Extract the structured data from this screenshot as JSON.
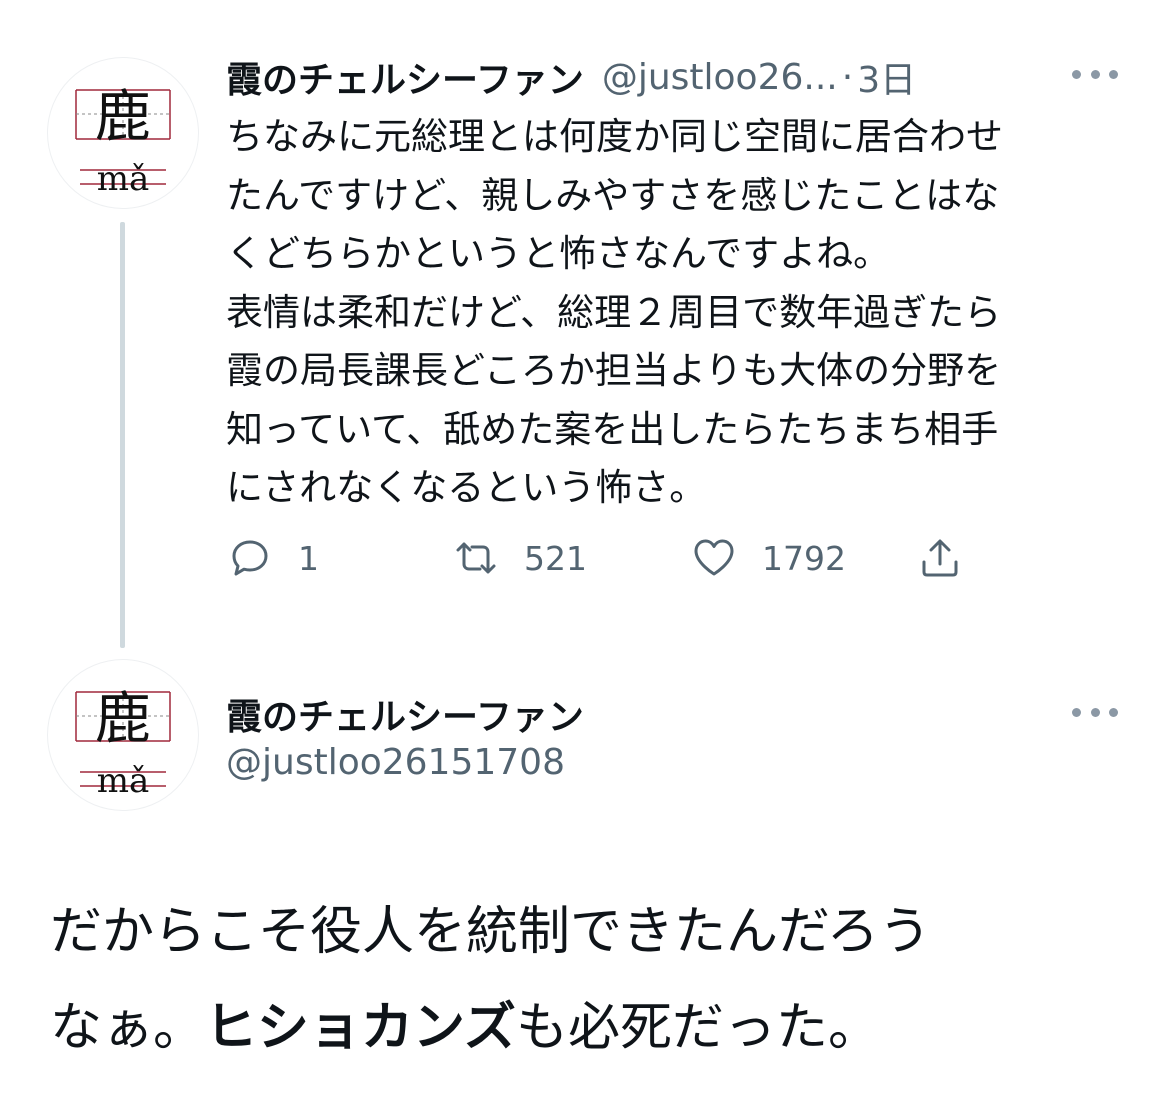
{
  "tweet1": {
    "avatar": {
      "glyph": "鹿",
      "pinyin": "mǎ"
    },
    "display_name": "霞のチェルシーファン",
    "handle": "@justloo26...",
    "dot": "·",
    "time": "3日",
    "lines": [
      "ちなみに元総理とは何度か同じ空間に居合わせ",
      "たんですけど、親しみやすさを感じたことはな",
      "くどちらかというと怖さなんですよね。",
      "表情は柔和だけど、総理２周目で数年過ぎたら",
      "霞の局長課長どころか担当よりも大体の分野を",
      "知っていて、舐めた案を出したらたちまち相手",
      "にされなくなるという怖さ。"
    ],
    "actions": {
      "reply_count": "1",
      "retweet_count": "521",
      "like_count": "1792"
    }
  },
  "tweet2": {
    "avatar": {
      "glyph": "鹿",
      "pinyin": "mǎ"
    },
    "display_name": "霞のチェルシーファン",
    "handle": "@justloo26151708",
    "text_line1": "だからこそ役人を統制できたんだろう",
    "text_line2_start": "なぁ。",
    "text_line2_bold": "ヒショカンズ",
    "text_line2_end": "も必死だった。"
  },
  "colors": {
    "text": "#0f1419",
    "secondary": "#536471",
    "thread_line": "#cfd9de",
    "avatar_rule": "#a0283c"
  },
  "icons": [
    "reply-icon",
    "retweet-icon",
    "like-icon",
    "share-icon",
    "more-icon"
  ]
}
